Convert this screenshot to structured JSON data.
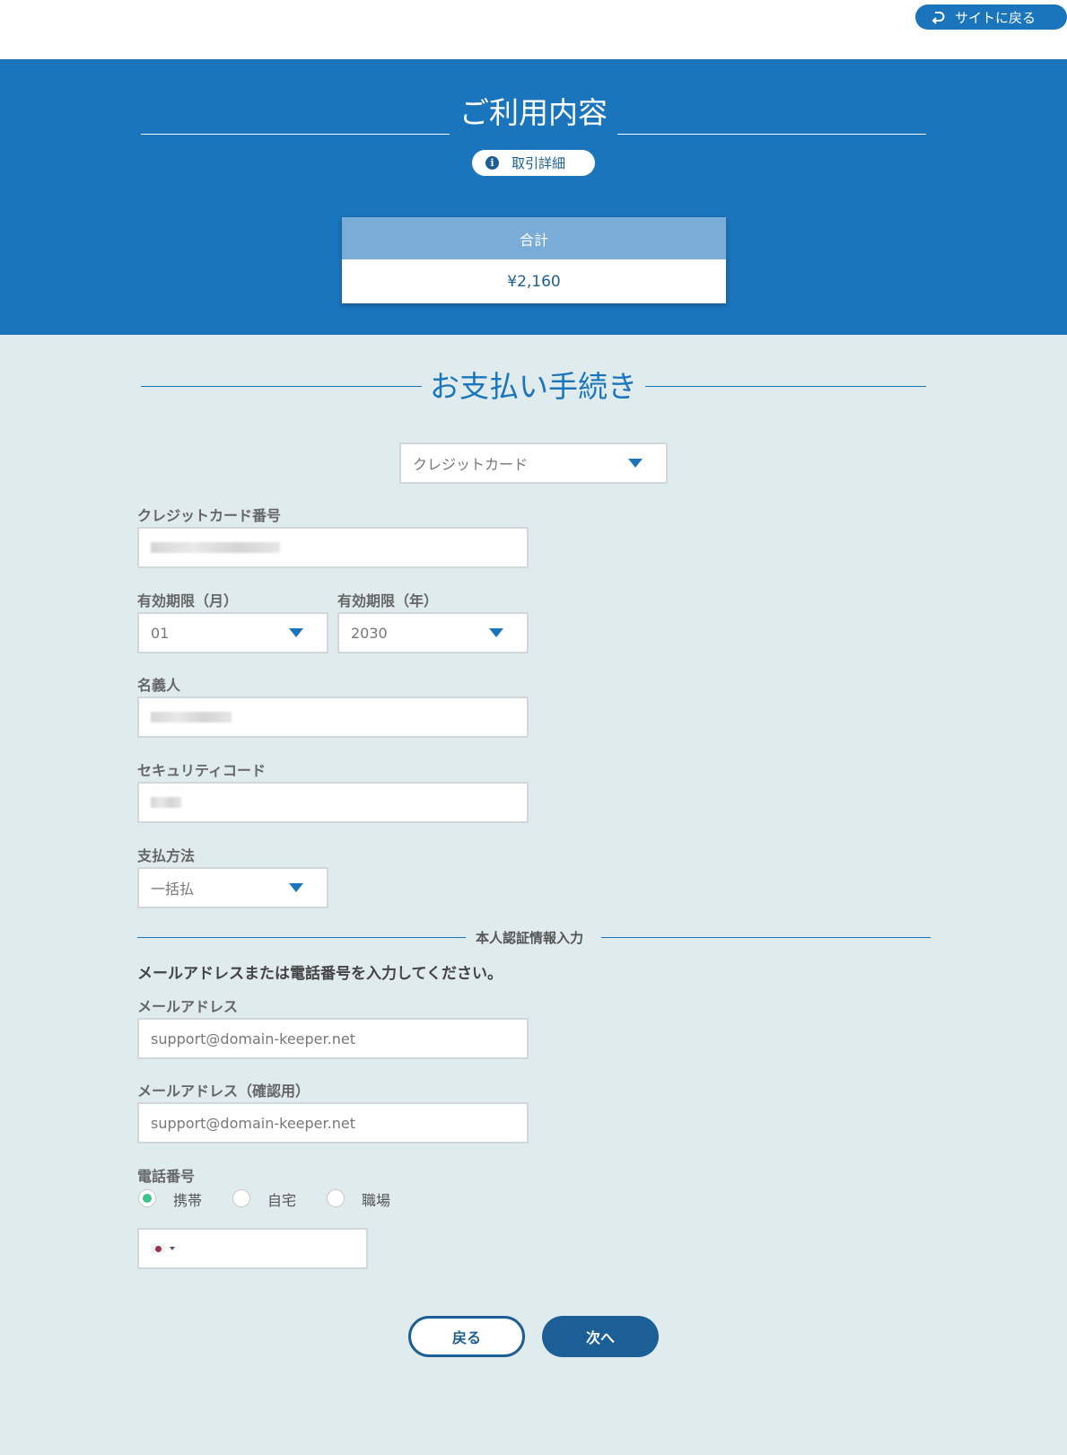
{
  "header": {
    "back_to_site_label": "サイトに戻る"
  },
  "summary": {
    "title": "ご利用内容",
    "detail_button_label": "取引詳細",
    "total_label": "合計",
    "total_value": "¥2,160"
  },
  "payment": {
    "title": "お支払い手続き",
    "method_selected": "クレジットカード",
    "card_number_label": "クレジットカード番号",
    "expiry_month_label": "有効期限（月）",
    "expiry_month_value": "01",
    "expiry_year_label": "有効期限（年）",
    "expiry_year_value": "2030",
    "holder_label": "名義人",
    "security_code_label": "セキュリティコード",
    "pay_method_label": "支払方法",
    "pay_method_value": "一括払"
  },
  "auth": {
    "section_label": "本人認証情報入力",
    "instruction": "メールアドレスまたは電話番号を入力してください。",
    "email_label": "メールアドレス",
    "email_value": "support@domain-keeper.net",
    "email_confirm_label": "メールアドレス（確認用）",
    "email_confirm_value": "support@domain-keeper.net",
    "phone_label": "電話番号",
    "phone_types": [
      {
        "label": "携帯",
        "selected": true
      },
      {
        "label": "自宅",
        "selected": false
      },
      {
        "label": "職場",
        "selected": false
      }
    ]
  },
  "actions": {
    "back_label": "戻る",
    "next_label": "次へ"
  },
  "colors": {
    "primary": "#1b75bc",
    "dark_primary": "#1b5f96",
    "background": "#e0ebee",
    "radio_on": "#3bc48e"
  }
}
